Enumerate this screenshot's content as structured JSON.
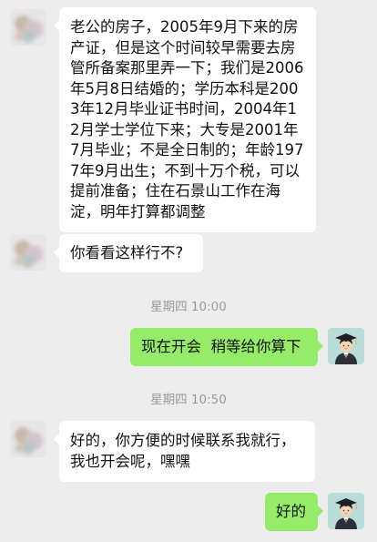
{
  "messages": [
    {
      "side": "in",
      "text": "老公的房子，2005年9月下来的房产证，但是这个时间较早需要去房管所备案那里弄一下；我们是2006年5月8日结婚的；学历本科是2003年12月毕业证书时间，2004年12月学士学位下来；大专是2001年7月毕业；不是全日制的；年龄1977年9月出生；不到十万个税，可以提前准备；住在石景山工作在海淀，明年打算都调整"
    },
    {
      "side": "in",
      "text": "你看看这样行不?"
    },
    {
      "side": "time",
      "text": "星期四 10:00"
    },
    {
      "side": "out",
      "text": "现在开会  稍等给你算下"
    },
    {
      "side": "time",
      "text": "星期四 10:50"
    },
    {
      "side": "in",
      "text": "好的，你方便的时候联系我就行，我也开会呢，嘿嘿"
    },
    {
      "side": "out",
      "text": "好的"
    }
  ],
  "avatars": {
    "contact": "blurred-avatar-icon",
    "self": "graduate-avatar-icon"
  },
  "colors": {
    "background": "#ededed",
    "incoming_bubble": "#ffffff",
    "outgoing_bubble": "#95ec69",
    "timestamp": "#9a9a9a",
    "self_avatar_bg": "#b9ddd9"
  }
}
